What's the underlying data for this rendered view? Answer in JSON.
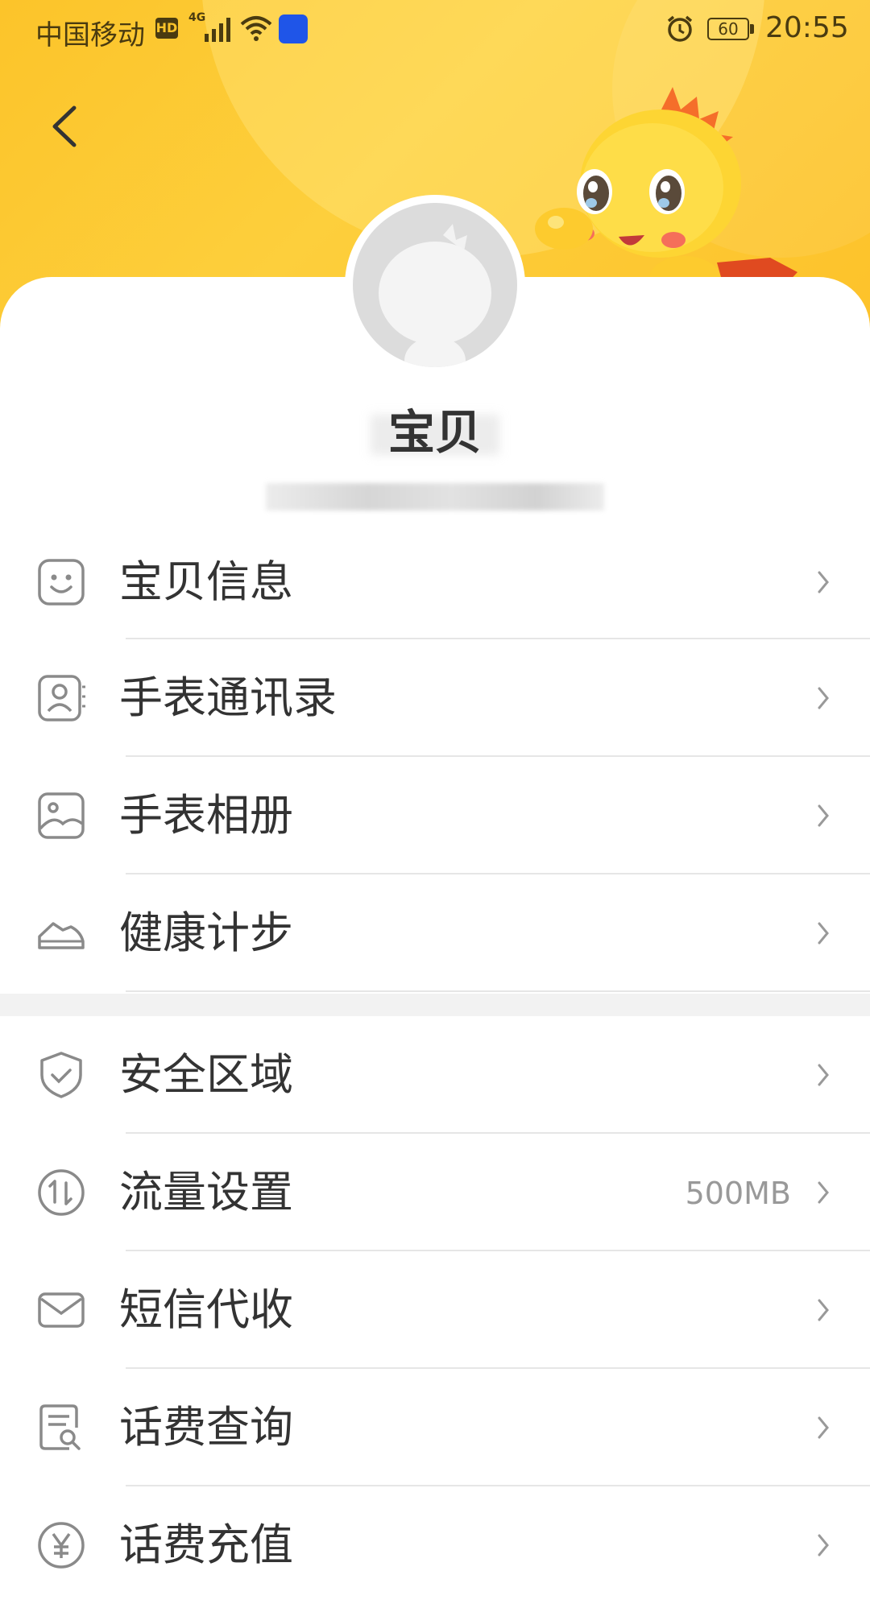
{
  "status_bar": {
    "carrier": "中国移动",
    "hd_badge": "HD",
    "network": "4G",
    "battery": "60",
    "time": "20:55"
  },
  "profile": {
    "name": "宝贝"
  },
  "menu_sections": [
    {
      "items": [
        {
          "label": "宝贝信息",
          "icon": "smile-face-icon"
        },
        {
          "label": "手表通讯录",
          "icon": "contact-card-icon"
        },
        {
          "label": "手表相册",
          "icon": "picture-icon"
        },
        {
          "label": "健康计步",
          "icon": "shoe-icon"
        }
      ]
    },
    {
      "items": [
        {
          "label": "安全区域",
          "icon": "shield-check-icon"
        },
        {
          "label": "流量设置",
          "icon": "data-traffic-icon",
          "value": "500MB"
        },
        {
          "label": "短信代收",
          "icon": "envelope-icon"
        },
        {
          "label": "话费查询",
          "icon": "bill-search-icon"
        },
        {
          "label": "话费充值",
          "icon": "yuan-icon"
        }
      ]
    }
  ],
  "colors": {
    "header_yellow": "#fcc42a",
    "icon_gray": "#8a8a8a",
    "text_dark": "#333333",
    "value_gray": "#999999"
  }
}
